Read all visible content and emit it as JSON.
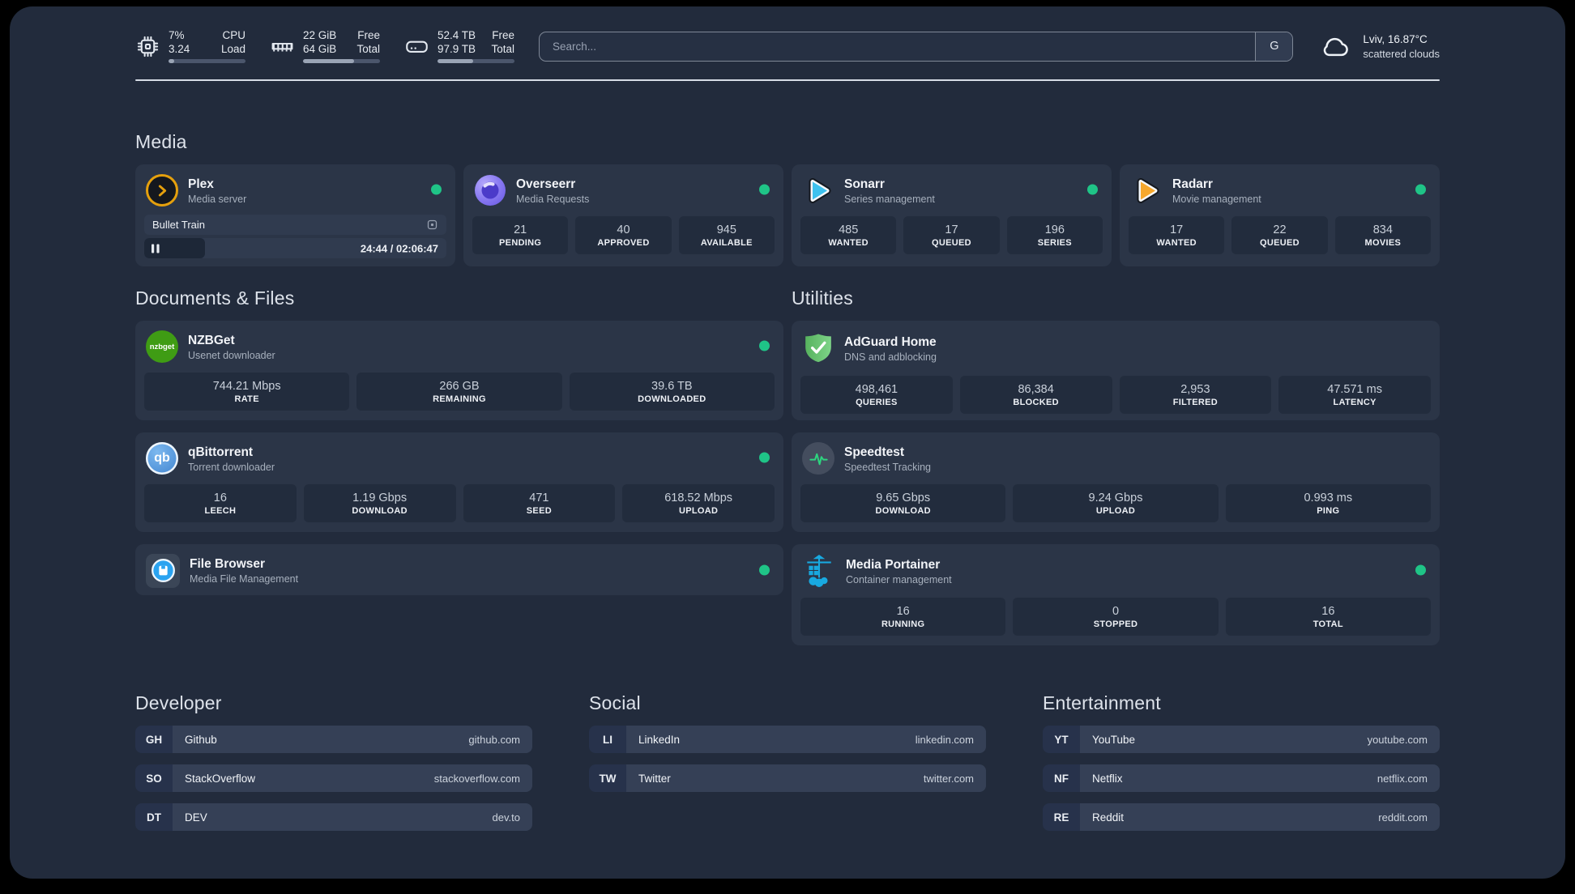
{
  "header": {
    "stats": [
      {
        "name": "cpu",
        "value_top": "7%",
        "value_bottom": "3.24",
        "label_top": "CPU",
        "label_bottom": "Load",
        "progress": 7
      },
      {
        "name": "ram",
        "value_top": "22 GiB",
        "value_bottom": "64 GiB",
        "label_top": "Free",
        "label_bottom": "Total",
        "progress": 66
      },
      {
        "name": "disk",
        "value_top": "52.4 TB",
        "value_bottom": "97.9 TB",
        "label_top": "Free",
        "label_bottom": "Total",
        "progress": 46
      }
    ],
    "search": {
      "placeholder": "Search...",
      "engine_label": "G"
    },
    "weather": {
      "location": "Lviv, 16.87°C",
      "condition": "scattered clouds"
    }
  },
  "media": {
    "heading": "Media",
    "plex": {
      "title": "Plex",
      "subtitle": "Media server",
      "now_playing": "Bullet Train",
      "time": "24:44 / 02:06:47",
      "progress": 20
    },
    "overseerr": {
      "title": "Overseerr",
      "subtitle": "Media Requests",
      "stats": [
        {
          "value": "21",
          "label": "PENDING"
        },
        {
          "value": "40",
          "label": "APPROVED"
        },
        {
          "value": "945",
          "label": "AVAILABLE"
        }
      ]
    },
    "sonarr": {
      "title": "Sonarr",
      "subtitle": "Series management",
      "stats": [
        {
          "value": "485",
          "label": "WANTED"
        },
        {
          "value": "17",
          "label": "QUEUED"
        },
        {
          "value": "196",
          "label": "SERIES"
        }
      ]
    },
    "radarr": {
      "title": "Radarr",
      "subtitle": "Movie management",
      "stats": [
        {
          "value": "17",
          "label": "WANTED"
        },
        {
          "value": "22",
          "label": "QUEUED"
        },
        {
          "value": "834",
          "label": "MOVIES"
        }
      ]
    }
  },
  "documents": {
    "heading": "Documents & Files",
    "nzbget": {
      "title": "NZBGet",
      "subtitle": "Usenet downloader",
      "icon_text": "nzbget",
      "stats": [
        {
          "value": "744.21 Mbps",
          "label": "RATE"
        },
        {
          "value": "266 GB",
          "label": "REMAINING"
        },
        {
          "value": "39.6 TB",
          "label": "DOWNLOADED"
        }
      ]
    },
    "qbittorrent": {
      "title": "qBittorrent",
      "subtitle": "Torrent downloader",
      "icon_text": "qb",
      "stats": [
        {
          "value": "16",
          "label": "LEECH"
        },
        {
          "value": "1.19 Gbps",
          "label": "DOWNLOAD"
        },
        {
          "value": "471",
          "label": "SEED"
        },
        {
          "value": "618.52 Mbps",
          "label": "UPLOAD"
        }
      ]
    },
    "filebrowser": {
      "title": "File Browser",
      "subtitle": "Media File Management"
    }
  },
  "utilities": {
    "heading": "Utilities",
    "adguard": {
      "title": "AdGuard Home",
      "subtitle": "DNS and adblocking",
      "stats": [
        {
          "value": "498,461",
          "label": "QUERIES"
        },
        {
          "value": "86,384",
          "label": "BLOCKED"
        },
        {
          "value": "2,953",
          "label": "FILTERED"
        },
        {
          "value": "47.571 ms",
          "label": "LATENCY"
        }
      ]
    },
    "speedtest": {
      "title": "Speedtest",
      "subtitle": "Speedtest Tracking",
      "stats": [
        {
          "value": "9.65 Gbps",
          "label": "DOWNLOAD"
        },
        {
          "value": "9.24 Gbps",
          "label": "UPLOAD"
        },
        {
          "value": "0.993 ms",
          "label": "PING"
        }
      ]
    },
    "portainer": {
      "title": "Media Portainer",
      "subtitle": "Container management",
      "stats": [
        {
          "value": "16",
          "label": "RUNNING"
        },
        {
          "value": "0",
          "label": "STOPPED"
        },
        {
          "value": "16",
          "label": "TOTAL"
        }
      ]
    }
  },
  "links": {
    "developer": {
      "heading": "Developer",
      "items": [
        {
          "tag": "GH",
          "name": "Github",
          "url": "github.com"
        },
        {
          "tag": "SO",
          "name": "StackOverflow",
          "url": "stackoverflow.com"
        },
        {
          "tag": "DT",
          "name": "DEV",
          "url": "dev.to"
        }
      ]
    },
    "social": {
      "heading": "Social",
      "items": [
        {
          "tag": "LI",
          "name": "LinkedIn",
          "url": "linkedin.com"
        },
        {
          "tag": "TW",
          "name": "Twitter",
          "url": "twitter.com"
        }
      ]
    },
    "entertainment": {
      "heading": "Entertainment",
      "items": [
        {
          "tag": "YT",
          "name": "YouTube",
          "url": "youtube.com"
        },
        {
          "tag": "NF",
          "name": "Netflix",
          "url": "netflix.com"
        },
        {
          "tag": "RE",
          "name": "Reddit",
          "url": "reddit.com"
        }
      ]
    }
  },
  "colors": {
    "status_online": "#1fc487",
    "plex": "#e5a00d",
    "sonarr": "#3ec1ee",
    "radarr": "#f7a82d",
    "adguard": "#68c46d",
    "portainer": "#18a9e0",
    "speedtest": "#2ed47f",
    "qbittorrent": "#4f9bdf",
    "nzbget": "#3f9c14",
    "overseerr": "#8a7bf2",
    "filebrowser": "#2aa3f0"
  }
}
